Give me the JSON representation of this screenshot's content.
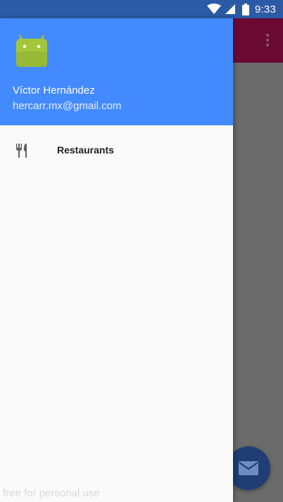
{
  "status_bar": {
    "time": "9:33",
    "icons": [
      "wifi-icon",
      "signal-icon",
      "battery-icon"
    ]
  },
  "toolbar": {
    "overflow_icon": "more-vert-icon"
  },
  "drawer": {
    "user_name": "Víctor Hernández",
    "user_email": "hercarr.mx@gmail.com",
    "avatar_icon": "android-icon",
    "items": [
      {
        "icon": "restaurant-icon",
        "label": "Restaurants"
      }
    ]
  },
  "fab": {
    "icon": "mail-icon"
  },
  "watermark": "free for personal use",
  "colors": {
    "status_bar": "#2b5aa6",
    "drawer_header": "#448aff",
    "toolbar": "#6a0a33",
    "scrim": "#6b6b6b",
    "fab": "#1f3e75"
  }
}
